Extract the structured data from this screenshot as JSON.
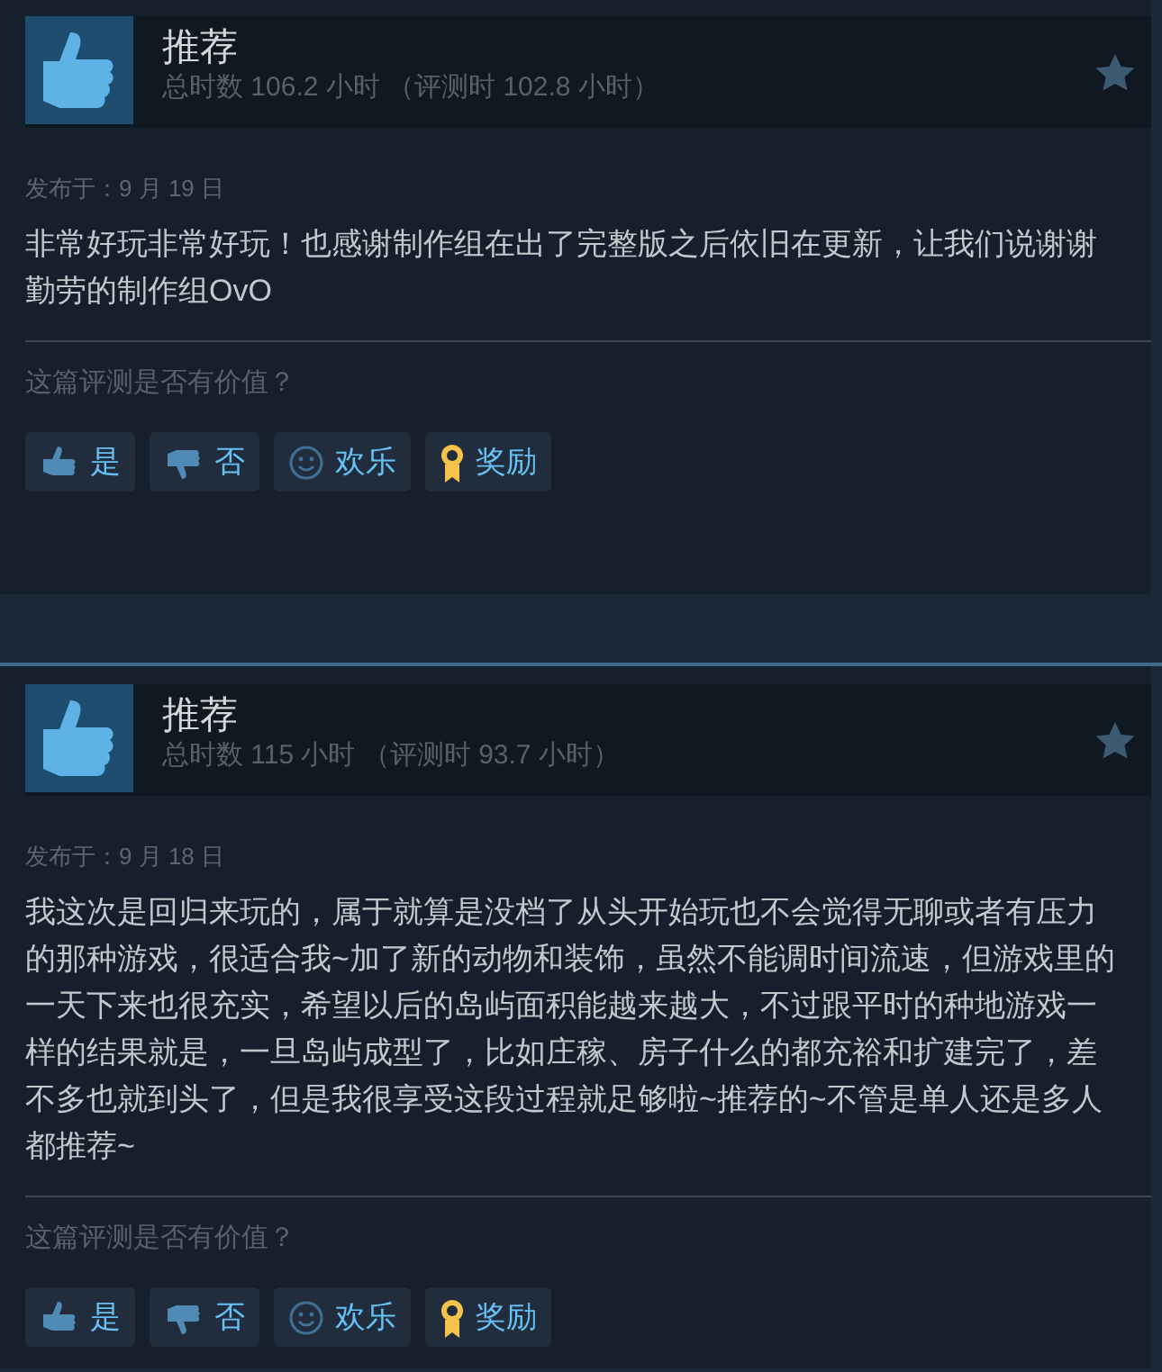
{
  "reviews": [
    {
      "recommendation": "推荐",
      "hours": "总时数 106.2 小时 （评测时 102.8 小时）",
      "date": "发布于：9 月 19 日",
      "body": "非常好玩非常好玩！也感谢制作组在出了完整版之后依旧在更新，让我们说谢谢勤劳的制作组OvO",
      "question": "这篇评测是否有价值？",
      "buttons": [
        {
          "kind": "yes",
          "label": "是"
        },
        {
          "kind": "no",
          "label": "否"
        },
        {
          "kind": "funny",
          "label": "欢乐"
        },
        {
          "kind": "award",
          "label": "奖励"
        }
      ]
    },
    {
      "recommendation": "推荐",
      "hours": "总时数 115 小时 （评测时 93.7 小时）",
      "date": "发布于：9 月 18 日",
      "body": "我这次是回归来玩的，属于就算是没档了从头开始玩也不会觉得无聊或者有压力的那种游戏，很适合我~加了新的动物和装饰，虽然不能调时间流速，但游戏里的一天下来也很充实，希望以后的岛屿面积能越来越大，不过跟平时的种地游戏一样的结果就是，一旦岛屿成型了，比如庄稼、房子什么的都充裕和扩建完了，差不多也就到头了，但是我很享受这段过程就足够啦~推荐的~不管是单人还是多人都推荐~",
      "question": "这篇评测是否有价值？",
      "buttons": [
        {
          "kind": "yes",
          "label": "是"
        },
        {
          "kind": "no",
          "label": "否"
        },
        {
          "kind": "funny",
          "label": "欢乐"
        },
        {
          "kind": "award",
          "label": "奖励"
        }
      ]
    }
  ]
}
